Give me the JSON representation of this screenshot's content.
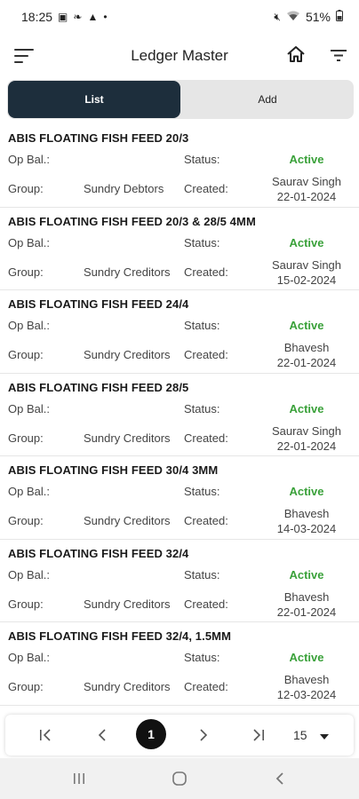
{
  "statusbar": {
    "time": "18:25",
    "battery": "51%"
  },
  "header": {
    "title": "Ledger Master"
  },
  "icons": {
    "menu": "hamburger-icon",
    "home": "home-icon",
    "filter": "filter-icon",
    "first": "first-page-icon",
    "prev": "prev-page-icon",
    "next": "next-page-icon",
    "last": "last-page-icon",
    "dropdown": "dropdown-icon"
  },
  "tabs": [
    {
      "label": "List",
      "active": true
    },
    {
      "label": "Add",
      "active": false
    }
  ],
  "labels": {
    "op_bal": "Op Bal.:",
    "status": "Status:",
    "group": "Group:",
    "created": "Created:"
  },
  "ledgers": [
    {
      "name": "ABIS FLOATING FISH FEED 20/3",
      "status": "Active",
      "group": "Sundry Debtors",
      "created_by": "Saurav Singh",
      "created_on": "22-01-2024"
    },
    {
      "name": "ABIS FLOATING FISH FEED 20/3 & 28/5 4MM",
      "status": "Active",
      "group": "Sundry Creditors",
      "created_by": "Saurav Singh",
      "created_on": "15-02-2024"
    },
    {
      "name": "ABIS FLOATING FISH FEED 24/4",
      "status": "Active",
      "group": "Sundry Creditors",
      "created_by": "Bhavesh",
      "created_on": "22-01-2024"
    },
    {
      "name": "ABIS FLOATING FISH FEED 28/5",
      "status": "Active",
      "group": "Sundry Creditors",
      "created_by": "Saurav Singh",
      "created_on": "22-01-2024"
    },
    {
      "name": "ABIS FLOATING FISH FEED 30/4 3MM",
      "status": "Active",
      "group": "Sundry Creditors",
      "created_by": "Bhavesh",
      "created_on": "14-03-2024"
    },
    {
      "name": "ABIS FLOATING FISH FEED 32/4",
      "status": "Active",
      "group": "Sundry Creditors",
      "created_by": "Bhavesh",
      "created_on": "22-01-2024"
    },
    {
      "name": "ABIS FLOATING FISH FEED 32/4, 1.5MM",
      "status": "Active",
      "group": "Sundry Creditors",
      "created_by": "Bhavesh",
      "created_on": "12-03-2024"
    }
  ],
  "pagination": {
    "current_page": "1",
    "page_size": "15"
  },
  "colors": {
    "tab_active": "#1d2e3c",
    "status_active": "#3aa13a"
  }
}
